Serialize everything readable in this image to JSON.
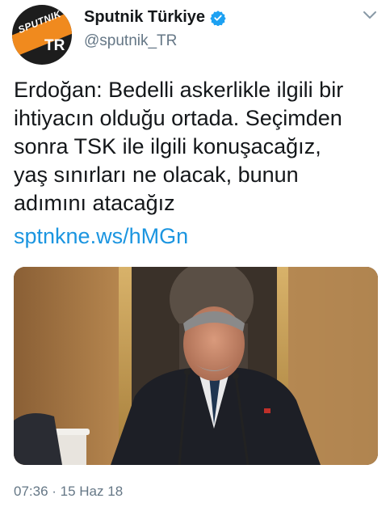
{
  "account": {
    "display_name": "Sputnik Türkiye",
    "handle": "@sputnik_TR",
    "avatar_logo_text": "SPUTNIK",
    "avatar_tr_text": "TR",
    "verified": true
  },
  "tweet": {
    "text_lines": [
      "Erdoğan: Bedelli askerlikle ilgili bir",
      "ihtiyacın olduğu ortada. Seçimden",
      "sonra TSK ile ilgili konuşacağız,",
      "yaş sınırları ne olacak, bunun",
      "adımını atacağız"
    ],
    "link": "sptnkne.ws/hMGn",
    "timestamp": "07:36 · 15 Haz 18"
  },
  "icons": {
    "verified": "verified-badge-icon",
    "menu": "chevron-down-icon"
  },
  "colors": {
    "link": "#1b95e0",
    "secondary_text": "#657786",
    "verified_badge": "#1da1f2",
    "brand_orange": "#f08a1e"
  }
}
